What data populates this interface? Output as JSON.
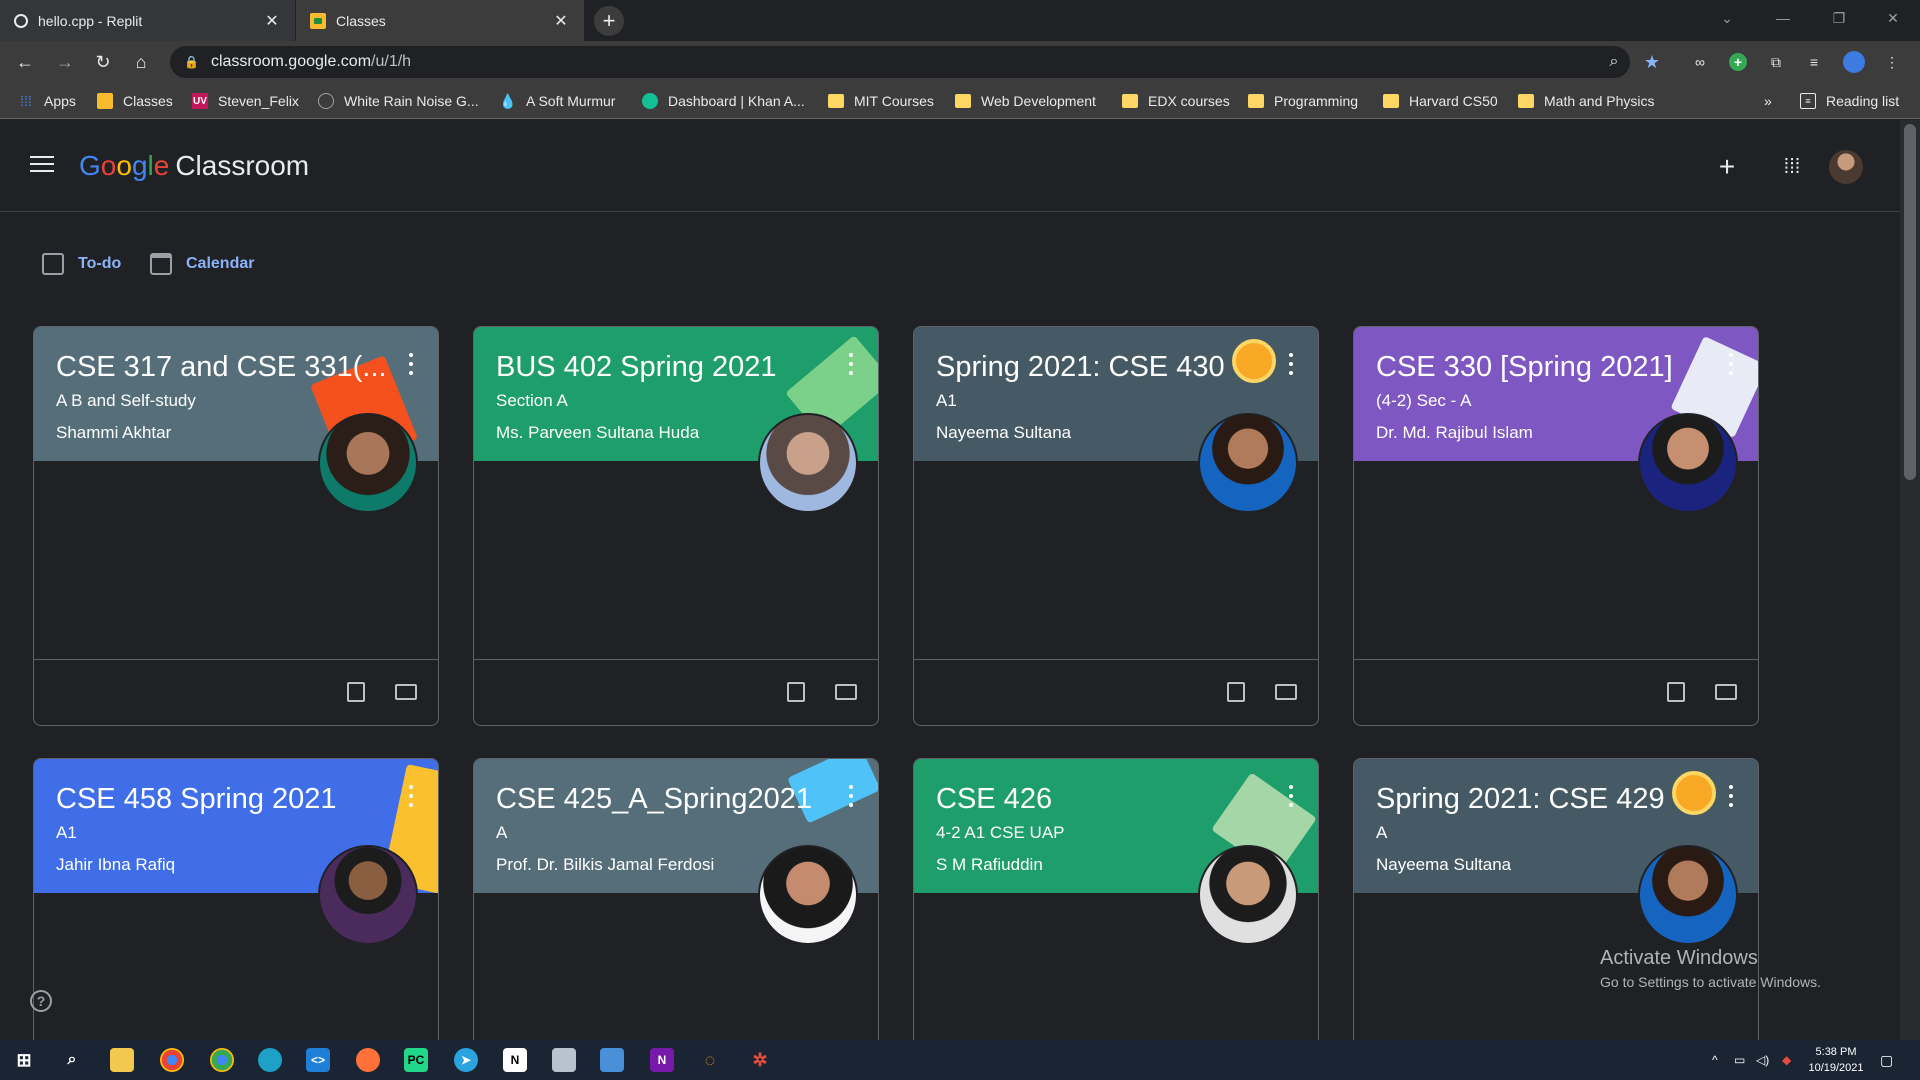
{
  "browser": {
    "tabs": [
      {
        "title": "hello.cpp - Replit",
        "active": false
      },
      {
        "title": "Classes",
        "active": true
      }
    ],
    "url_main": "classroom.google.com",
    "url_path": "/u/1/h",
    "bookmarks": [
      {
        "label": "Apps",
        "icon": "apps-grid-icon"
      },
      {
        "label": "Classes",
        "icon": "classroom-icon"
      },
      {
        "label": "Steven_Felix",
        "icon": "uva-icon"
      },
      {
        "label": "White Rain Noise G...",
        "icon": "noise-icon"
      },
      {
        "label": "A Soft Murmur",
        "icon": "droplet-icon"
      },
      {
        "label": "Dashboard | Khan A...",
        "icon": "khan-icon"
      },
      {
        "label": "MIT Courses",
        "icon": "folder-icon"
      },
      {
        "label": "Web Development",
        "icon": "folder-icon"
      },
      {
        "label": "EDX courses",
        "icon": "folder-icon"
      },
      {
        "label": "Programming",
        "icon": "folder-icon"
      },
      {
        "label": "Harvard CS50",
        "icon": "folder-icon"
      },
      {
        "label": "Math and Physics",
        "icon": "folder-icon"
      }
    ],
    "overflow_label": "»",
    "reading_list": "Reading list"
  },
  "app": {
    "brand_google": [
      "G",
      "o",
      "o",
      "g",
      "l",
      "e"
    ],
    "brand_product": "Classroom",
    "todo_label": "To-do",
    "calendar_label": "Calendar"
  },
  "cards": [
    {
      "title": "CSE 317 and CSE 331(...",
      "section": "A B and Self-study",
      "teacher": "Shammi Akhtar",
      "color": "#566e7a"
    },
    {
      "title": "BUS 402 Spring 2021",
      "section": "Section A",
      "teacher": "Ms. Parveen Sultana Huda",
      "color": "#1e9e6a"
    },
    {
      "title": "Spring 2021: CSE 430",
      "section": "A1",
      "teacher": "Nayeema Sultana",
      "color": "#455a64"
    },
    {
      "title": "CSE 330 [Spring 2021]",
      "section": "(4-2) Sec - A",
      "teacher": "Dr. Md. Rajibul Islam",
      "color": "#7e57c2"
    },
    {
      "title": "CSE 458 Spring 2021",
      "section": "A1",
      "teacher": "Jahir Ibna Rafiq",
      "color": "#3f6ee8"
    },
    {
      "title": "CSE 425_A_Spring2021",
      "section": "A",
      "teacher": "Prof. Dr. Bilkis Jamal Ferdosi",
      "color": "#566e7a"
    },
    {
      "title": "CSE 426",
      "section": "4-2 A1 CSE UAP",
      "teacher": "S M Rafiuddin",
      "color": "#1e9e6a"
    },
    {
      "title": "Spring 2021: CSE 429",
      "section": "A",
      "teacher": "Nayeema Sultana",
      "color": "#455a64"
    }
  ],
  "watermark": {
    "line1": "Activate Windows",
    "line2": "Go to Settings to activate Windows."
  },
  "help_glyph": "?",
  "taskbar": {
    "time": "5:38 PM",
    "date": "10/19/2021"
  }
}
